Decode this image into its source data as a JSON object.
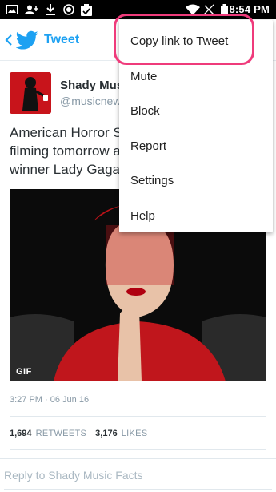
{
  "status_bar": {
    "time": "8:54 PM",
    "icons": [
      "image-icon",
      "add-person-icon",
      "download-icon",
      "record-icon",
      "clipboard-check-icon",
      "wifi-icon",
      "no-signal-icon",
      "battery-icon"
    ]
  },
  "app_bar": {
    "back_icon": "chevron-left-icon",
    "logo_icon": "twitter-bird-icon",
    "title": "Tweet"
  },
  "tweet": {
    "author_name": "Shady Mus",
    "author_handle": "@musicnew",
    "text": "American Horror S\nfilming tomorrow a\nwinner Lady Gaga",
    "media_badge": "GIF",
    "timestamp": "3:27 PM · 06 Jun 16",
    "retweets_count": "1,694",
    "retweets_label": "RETWEETS",
    "likes_count": "3,176",
    "likes_label": "LIKES"
  },
  "reply": {
    "placeholder": "Reply to Shady Music Facts"
  },
  "menu": {
    "items": [
      "Copy link to Tweet",
      "Mute",
      "Block",
      "Report",
      "Settings",
      "Help"
    ],
    "highlighted_item": "Copy link to Tweet"
  },
  "colors": {
    "accent": "#1da1f2",
    "highlight": "#ef3b7b",
    "avatar_bg": "#c8141b"
  }
}
